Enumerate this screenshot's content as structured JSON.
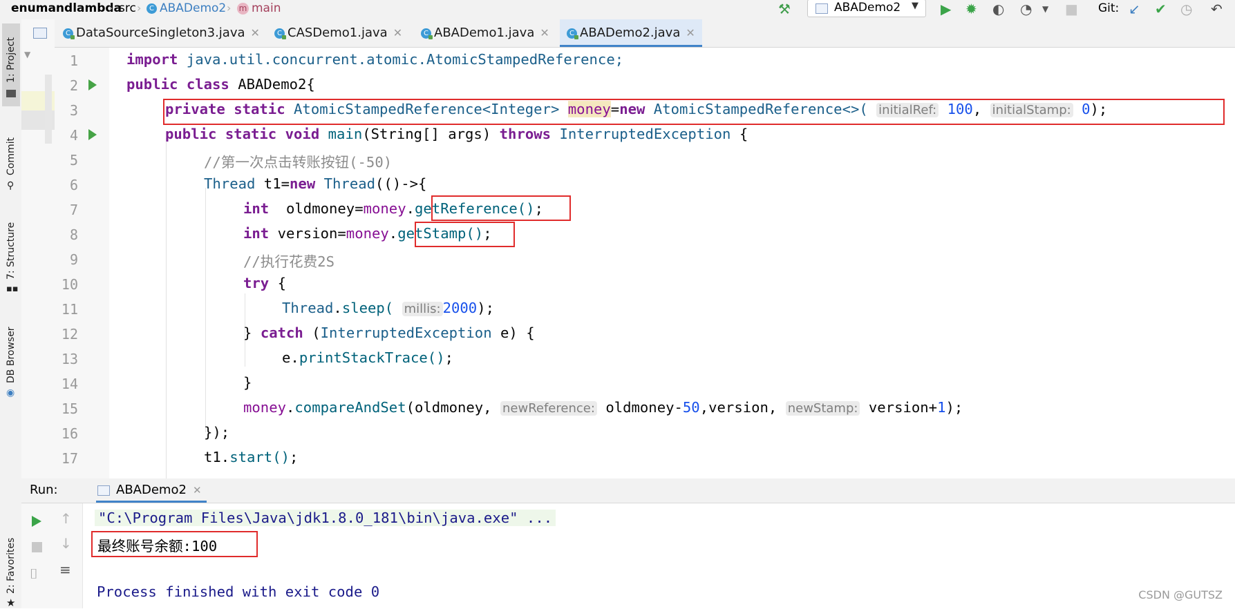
{
  "breadcrumb": {
    "project": "enumandlambda",
    "src": "src",
    "file": "ABADemo2",
    "method": "main"
  },
  "toolbar": {
    "run_config": "ABADemo2",
    "git_label": "Git:"
  },
  "left_tool_tabs": [
    "1: Project",
    "Commit",
    "7: Structure",
    "DB Browser",
    "2: Favorites"
  ],
  "editor_tabs": [
    {
      "label": "DataSourceSingleton3.java",
      "active": false
    },
    {
      "label": "CASDemo1.java",
      "active": false
    },
    {
      "label": "ABADemo1.java",
      "active": false
    },
    {
      "label": "ABADemo2.java",
      "active": true
    }
  ],
  "line_numbers": [
    "1",
    "2",
    "3",
    "4",
    "5",
    "6",
    "7",
    "8",
    "9",
    "10",
    "11",
    "12",
    "13",
    "14",
    "15",
    "16",
    "17"
  ],
  "code": {
    "l1": {
      "kw": "import",
      "rest": " java.util.concurrent.atomic.AtomicStampedReference;"
    },
    "l2": {
      "kw1": "public",
      "kw2": "class",
      "rest": " ABADemo2{"
    },
    "l3": {
      "kw1": "private",
      "kw2": "static",
      "type": "AtomicStampedReference<Integer>",
      "field": "money",
      "eq": "=",
      "kw3": "new",
      "ctor": "AtomicStampedReference<>(",
      "hint1": "initialRef:",
      "v1": "100",
      "comma": ",",
      "hint2": "initialStamp:",
      "v2": "0",
      "end": ");"
    },
    "l4": {
      "kw1": "public",
      "kw2": "static",
      "kw3": "void",
      "method": "main",
      "params": "(String[] args) ",
      "kw4": "throws",
      "exc": "InterruptedException",
      "end": " {"
    },
    "l5": {
      "comment": "//第一次点击转账按钮(-50)"
    },
    "l6": {
      "type": "Thread",
      "mid": " t1=",
      "kw": "new",
      "type2": "Thread",
      "end": "(()->{"
    },
    "l7": {
      "kw": "int",
      "var": "  oldmoney=",
      "field": "money",
      "dot": ".",
      "method": "getReference()",
      "end": ";"
    },
    "l8": {
      "kw": "int",
      "var": " version=",
      "field": "money",
      "dot": ".",
      "method": "getStamp()",
      "end": ";"
    },
    "l9": {
      "comment": "//执行花费2S"
    },
    "l10": {
      "kw": "try",
      "end": " {"
    },
    "l11": {
      "type": "Thread",
      "dot": ".",
      "method": "sleep(",
      "hint": "millis:",
      "v": "2000",
      "end": ");"
    },
    "l12": {
      "open": "} ",
      "kw": "catch",
      "mid": " (",
      "type": "InterruptedException",
      "end": " e) {"
    },
    "l13": {
      "var": "e.",
      "method": "printStackTrace()",
      "end": ";"
    },
    "l14": {
      "text": "}"
    },
    "l15": {
      "field": "money",
      "dot": ".",
      "method": "compareAndSet",
      "a1": "(oldmoney, ",
      "hint1": "newReference:",
      "a2": "oldmoney-",
      "v1": "50",
      "a3": ",version, ",
      "hint2": "newStamp:",
      "a4": "version+",
      "v2": "1",
      "end": ");"
    },
    "l16": {
      "text": "});"
    },
    "l17": {
      "var": "t1.",
      "method": "start()",
      "end": ";"
    }
  },
  "run_panel": {
    "label": "Run:",
    "tab": "ABADemo2",
    "cmd_line": "\"C:\\Program Files\\Java\\jdk1.8.0_181\\bin\\java.exe\" ...",
    "result_line": "最终账号余额:100",
    "exit_line": "Process finished with exit code 0"
  },
  "watermark": "CSDN @GUTSZ",
  "colors": {
    "keyword": "#7a1d91",
    "type": "#1b5f8a",
    "field": "#871094",
    "number": "#1750eb",
    "comment": "#8c8c8c",
    "highlight_box": "#e02b2b",
    "active_tab": "#dee9f7"
  }
}
